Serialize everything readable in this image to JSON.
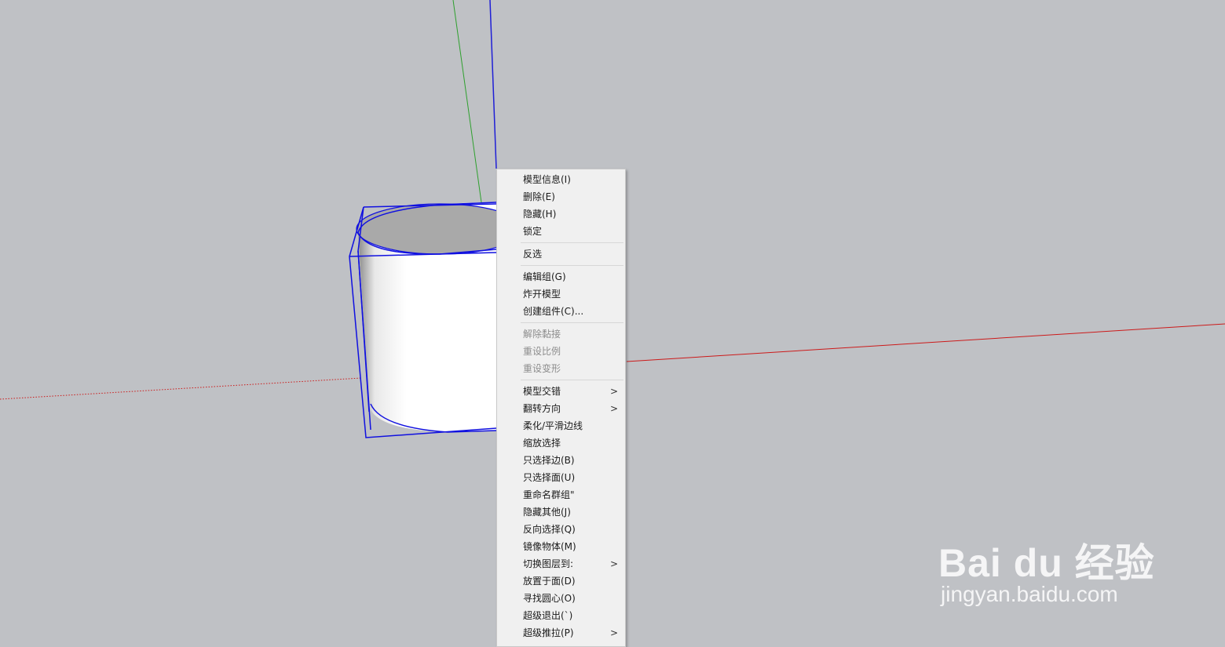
{
  "context_menu": {
    "items": [
      {
        "label": "模型信息(I)",
        "enabled": true,
        "submenu": false
      },
      {
        "label": "删除(E)",
        "enabled": true,
        "submenu": false
      },
      {
        "label": "隐藏(H)",
        "enabled": true,
        "submenu": false
      },
      {
        "label": "锁定",
        "enabled": true,
        "submenu": false
      },
      {
        "separator": true
      },
      {
        "label": "反选",
        "enabled": true,
        "submenu": false
      },
      {
        "separator": true
      },
      {
        "label": "编辑组(G)",
        "enabled": true,
        "submenu": false
      },
      {
        "label": "炸开模型",
        "enabled": true,
        "submenu": false
      },
      {
        "label": "创建组件(C)...",
        "enabled": true,
        "submenu": false
      },
      {
        "separator": true
      },
      {
        "label": "解除黏接",
        "enabled": false,
        "submenu": false
      },
      {
        "label": "重设比例",
        "enabled": false,
        "submenu": false
      },
      {
        "label": "重设变形",
        "enabled": false,
        "submenu": false
      },
      {
        "separator": true
      },
      {
        "label": "模型交错",
        "enabled": true,
        "submenu": true
      },
      {
        "label": "翻转方向",
        "enabled": true,
        "submenu": true
      },
      {
        "label": "柔化/平滑边线",
        "enabled": true,
        "submenu": false
      },
      {
        "label": "缩放选择",
        "enabled": true,
        "submenu": false
      },
      {
        "label": "只选择边(B)",
        "enabled": true,
        "submenu": false
      },
      {
        "label": "只选择面(U)",
        "enabled": true,
        "submenu": false
      },
      {
        "label": "重命名群组\"",
        "enabled": true,
        "submenu": false
      },
      {
        "label": "隐藏其他(J)",
        "enabled": true,
        "submenu": false
      },
      {
        "label": "反向选择(Q)",
        "enabled": true,
        "submenu": false
      },
      {
        "label": "镜像物体(M)",
        "enabled": true,
        "submenu": false
      },
      {
        "label": "切换图层到:",
        "enabled": true,
        "submenu": true
      },
      {
        "label": "放置于面(D)",
        "enabled": true,
        "submenu": false
      },
      {
        "label": "寻找圆心(O)",
        "enabled": true,
        "submenu": false
      },
      {
        "label": "超级退出(`)",
        "enabled": true,
        "submenu": false
      },
      {
        "label": "超级推拉(P)",
        "enabled": true,
        "submenu": true
      }
    ],
    "submenu_arrow": ">"
  },
  "watermark": {
    "logo_text": "Bai du 经验",
    "url": "jingyan.baidu.com"
  },
  "colors": {
    "background": "#bfc1c5",
    "axis_red": "#cc1a1a",
    "axis_green": "#2ea02e",
    "axis_blue": "#1f1fd6",
    "selection_blue": "#1010e0",
    "menu_bg": "#f0f0f0"
  },
  "icons": [
    "submenu-arrow-icon"
  ]
}
